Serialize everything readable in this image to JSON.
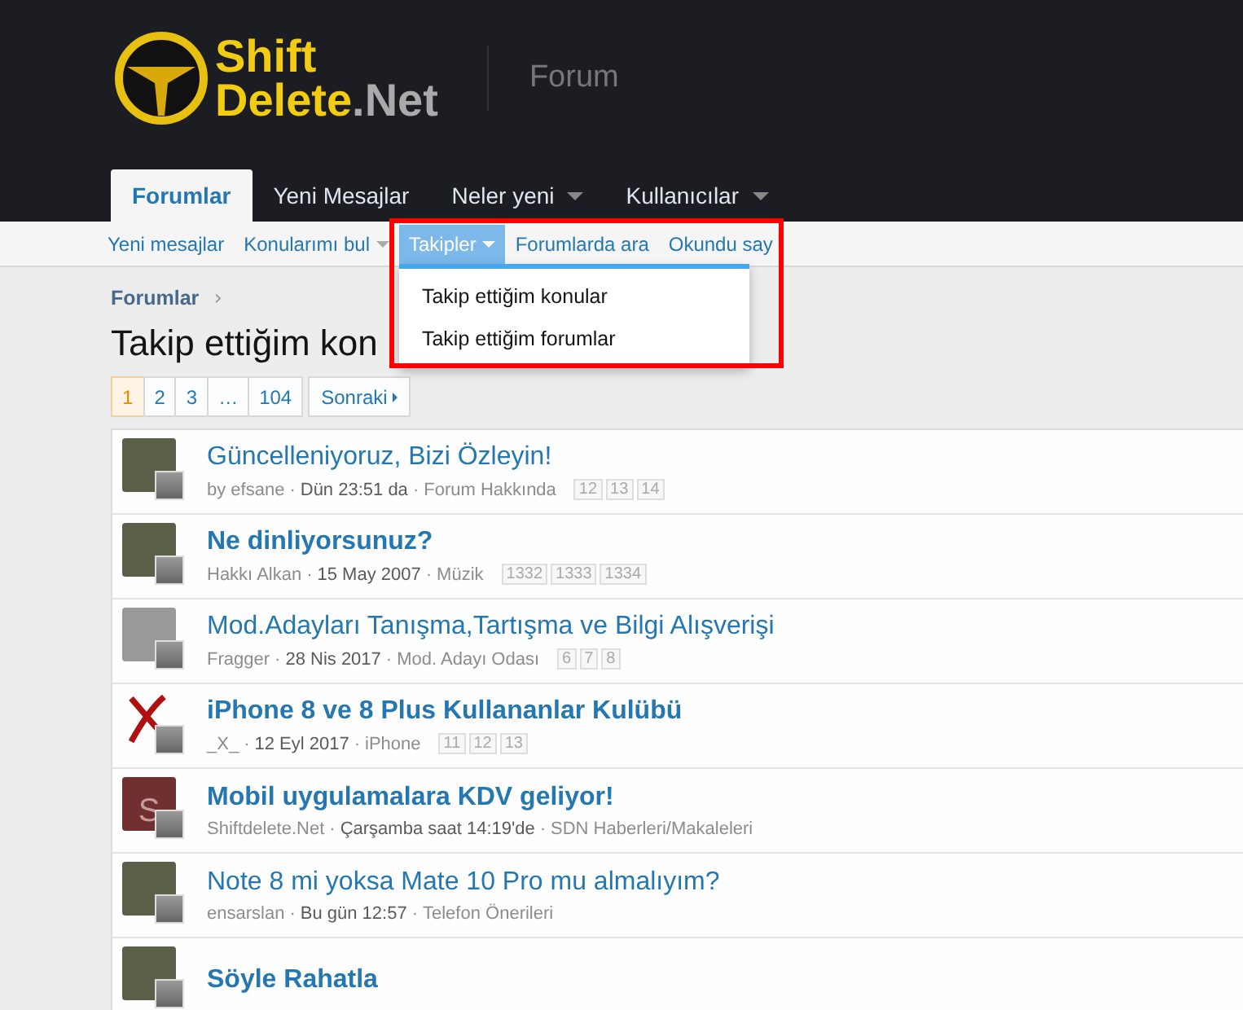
{
  "logo": {
    "line1": "Shift",
    "line2": "Delete",
    "line3": ".Net"
  },
  "section_title": "Forum",
  "tabs": [
    {
      "label": "Forumlar",
      "selected": true,
      "has_menu": false
    },
    {
      "label": "Yeni Mesajlar",
      "selected": false,
      "has_menu": false
    },
    {
      "label": "Neler yeni",
      "selected": false,
      "has_menu": true
    },
    {
      "label": "Kullanıcılar",
      "selected": false,
      "has_menu": true
    }
  ],
  "subnav": [
    {
      "label": "Yeni mesajlar",
      "selected": false,
      "has_menu": false
    },
    {
      "label": "Konularımı bul",
      "selected": false,
      "has_menu": true
    },
    {
      "label": "Takipler",
      "selected": true,
      "has_menu": true
    },
    {
      "label": "Forumlarda ara",
      "selected": false,
      "has_menu": false
    },
    {
      "label": "Okundu say",
      "selected": false,
      "has_menu": false
    }
  ],
  "dropdown": {
    "items": [
      "Takip ettiğim konular",
      "Takip ettiğim forumlar"
    ]
  },
  "breadcrumb": [
    {
      "label": "Forumlar",
      "separator": "›"
    }
  ],
  "page_title": "Takip ettiğim kon",
  "pagination": {
    "pages": [
      {
        "label": "1",
        "selected": true
      },
      {
        "label": "2",
        "selected": false
      },
      {
        "label": "3",
        "selected": false
      },
      {
        "label": "…",
        "selected": false
      },
      {
        "label": "104",
        "selected": false
      }
    ],
    "next": "Sonraki"
  },
  "threads": [
    {
      "title": "Güncelleniyoruz, Bizi Özleyin!",
      "unread": false,
      "avatar": {
        "kind": "photo"
      },
      "meta": [
        {
          "kind": "user",
          "text": "by efsane"
        },
        {
          "kind": "sep",
          "text": "·"
        },
        {
          "kind": "date",
          "text": "Dün 23:51 da"
        },
        {
          "kind": "sep",
          "text": "·"
        },
        {
          "kind": "forum",
          "text": "Forum Hakkında"
        }
      ],
      "pages": [
        "12",
        "13",
        "14"
      ]
    },
    {
      "title": "Ne dinliyorsunuz?",
      "unread": true,
      "avatar": {
        "kind": "photo"
      },
      "meta": [
        {
          "kind": "user",
          "text": "Hakkı Alkan"
        },
        {
          "kind": "sep",
          "text": "·"
        },
        {
          "kind": "date",
          "text": "15 May 2007"
        },
        {
          "kind": "sep",
          "text": "·"
        },
        {
          "kind": "forum",
          "text": "Müzik"
        }
      ],
      "pages": [
        "1332",
        "1333",
        "1334"
      ]
    },
    {
      "title": "Mod.Adayları Tanışma,Tartışma ve Bilgi Alışverişi",
      "unread": false,
      "avatar": {
        "kind": "blank"
      },
      "meta": [
        {
          "kind": "user",
          "text": "Fragger"
        },
        {
          "kind": "sep",
          "text": "·"
        },
        {
          "kind": "date",
          "text": "28 Nis 2017"
        },
        {
          "kind": "sep",
          "text": "·"
        },
        {
          "kind": "forum",
          "text": "Mod. Adayı Odası"
        }
      ],
      "pages": [
        "6",
        "7",
        "8"
      ]
    },
    {
      "title": "iPhone 8 ve 8 Plus Kullananlar Kulübü",
      "unread": true,
      "avatar": {
        "kind": "cross"
      },
      "meta": [
        {
          "kind": "user",
          "text": "_X_"
        },
        {
          "kind": "sep",
          "text": "·"
        },
        {
          "kind": "date",
          "text": "12 Eyl 2017"
        },
        {
          "kind": "sep",
          "text": "·"
        },
        {
          "kind": "forum",
          "text": "iPhone"
        }
      ],
      "pages": [
        "11",
        "12",
        "13"
      ]
    },
    {
      "title": "Mobil uygulamalara KDV geliyor!",
      "unread": true,
      "avatar": {
        "kind": "letter",
        "letter": "S"
      },
      "meta": [
        {
          "kind": "user",
          "text": "Shiftdelete.Net"
        },
        {
          "kind": "sep",
          "text": "·"
        },
        {
          "kind": "date",
          "text": "Çarşamba saat 14:19'de"
        },
        {
          "kind": "sep",
          "text": "·"
        },
        {
          "kind": "forum",
          "text": "SDN Haberleri/Makaleleri"
        }
      ]
    },
    {
      "title": "Note 8 mi yoksa Mate 10 Pro mu almalıyım?",
      "unread": false,
      "avatar": {
        "kind": "photo"
      },
      "meta": [
        {
          "kind": "user",
          "text": "ensarslan"
        },
        {
          "kind": "sep",
          "text": "·"
        },
        {
          "kind": "date",
          "text": "Bu gün 12:57"
        },
        {
          "kind": "sep",
          "text": "·"
        },
        {
          "kind": "forum",
          "text": "Telefon Önerileri"
        }
      ]
    },
    {
      "title": "Söyle Rahatla",
      "unread": true,
      "avatar": {
        "kind": "photo"
      }
    }
  ]
}
